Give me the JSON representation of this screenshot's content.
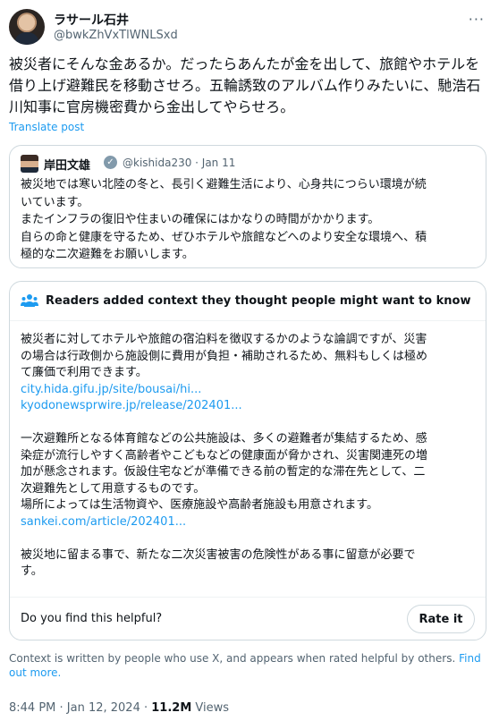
{
  "author": {
    "name": "ラサール石井",
    "handle": "@bwkZhVxTlWNLSxd"
  },
  "more_label": "···",
  "tweet": {
    "text_lines": [
      "被災者にそんな金あるか。だったらあんたが金を出して、旅館やホテルを",
      "借り上げ避難民を移動させろ。五輪誘致のアルバム作りみたいに、馳浩石",
      "川知事に官房機密費から金出してやらせろ。"
    ],
    "translate_label": "Translate post"
  },
  "quote": {
    "name": "岸田文雄",
    "verified_symbol": "✓",
    "handle_date": "@kishida230 · Jan 11",
    "text_lines": [
      "被災地では寒い北陸の冬と、長引く避難生活により、心身共につらい環境が続",
      "いています。",
      "またインフラの復旧や住まいの確保にはかなりの時間がかかります。",
      "自らの命と健康を守るため、ぜひホテルや旅館などへのより安全な環境へ、積",
      "極的な二次避難をお願いします。"
    ]
  },
  "community_note": {
    "header": "Readers added context they thought people might want to know",
    "para1_lines": [
      "被災者に対してホテルや旅館の宿泊料を徴収するかのような論調ですが、災害",
      "の場合は行政側から施設側に費用が負担・補助されるため、無料もしくは極め",
      "て廉価で利用できます。"
    ],
    "link1": "city.hida.gifu.jp/site/bousai/hi...",
    "link2": "kyodonewsprwire.jp/release/202401...",
    "para2_lines": [
      "一次避難所となる体育館などの公共施設は、多くの避難者が集結するため、感",
      "染症が流行しやすく高齢者やこどもなどの健康面が脅かされ、災害関連死の増",
      "加が懸念されます。仮設住宅などが準備できる前の暫定的な滞在先として、二",
      "次避難先として用意するものです。",
      "場所によっては生活物資や、医療施設や高齢者施設も用意されます。"
    ],
    "link3": "sankei.com/article/202401...",
    "para3_lines": [
      "被災地に留まる事で、新たな二次災害被害の危険性がある事に留意が必要で",
      "す。"
    ],
    "helpful_question": "Do you find this helpful?",
    "rate_label": "Rate it"
  },
  "context_footer": {
    "text": "Context is written by people who use X, and appears when rated helpful by others.",
    "link": "Find out more."
  },
  "meta": {
    "datetime": "8:44 PM · Jan 12, 2024 · ",
    "views_count": "11.2M",
    "views_label": " Views"
  },
  "colors": {
    "link": "#1d9bf0",
    "secondary_text": "#536471",
    "border": "#cfd9de"
  }
}
